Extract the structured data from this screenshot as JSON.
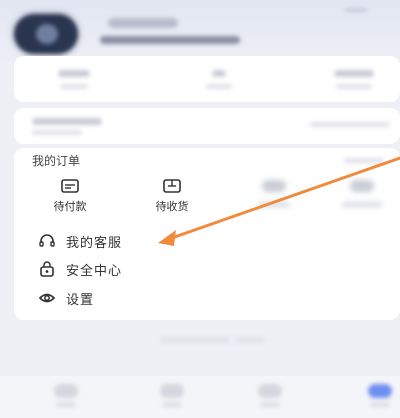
{
  "orders": {
    "title": "我的订单",
    "items": [
      {
        "label": "待付款",
        "icon": "wallet-card-icon"
      },
      {
        "label": "待收货",
        "icon": "package-icon"
      }
    ]
  },
  "menu": {
    "items": [
      {
        "label": "我的客服",
        "icon": "headset-icon"
      },
      {
        "label": "安全中心",
        "icon": "shield-icon"
      },
      {
        "label": "设置",
        "icon": "settings-icon"
      }
    ]
  },
  "colors": {
    "arrow": "#f08a3c",
    "background": "#eef0f6",
    "card": "#ffffff"
  }
}
